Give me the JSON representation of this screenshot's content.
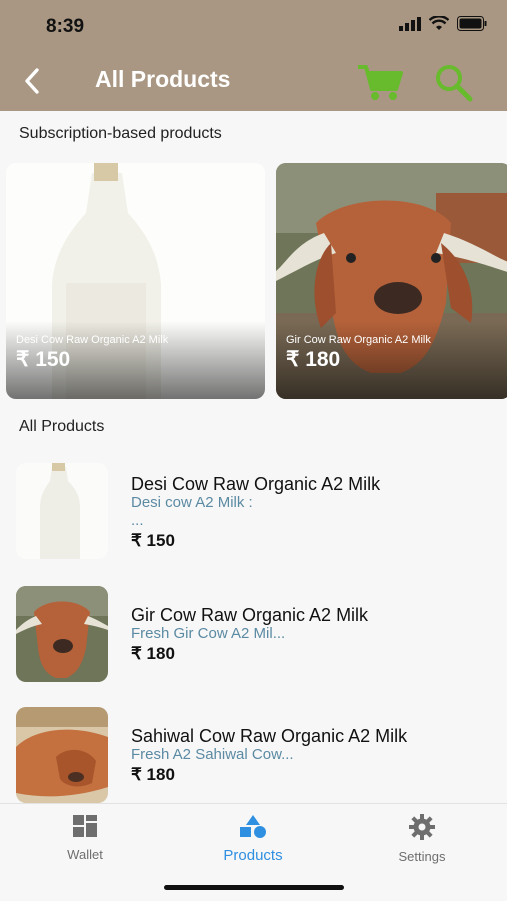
{
  "status_bar": {
    "time": "8:39"
  },
  "header": {
    "title": "All Products"
  },
  "sections": {
    "subscription_label": "Subscription-based products",
    "all_label": "All Products"
  },
  "subscription_cards": [
    {
      "name": "Desi Cow Raw Organic A2 Milk",
      "price": "₹ 150"
    },
    {
      "name": "Gir Cow Raw Organic A2 Milk",
      "price": "₹ 180"
    }
  ],
  "products": [
    {
      "name": "Desi Cow Raw Organic A2 Milk",
      "desc": "Desi cow A2 Milk :",
      "desc2": "...",
      "price": "₹ 150"
    },
    {
      "name": "Gir Cow Raw Organic A2 Milk",
      "desc": "Fresh Gir Cow A2 Mil...",
      "price": "₹ 180"
    },
    {
      "name": "Sahiwal Cow Raw Organic A2 Milk",
      "desc": "Fresh A2 Sahiwal Cow...",
      "price": "₹ 180"
    }
  ],
  "tabs": [
    {
      "label": "Wallet",
      "icon": "wallet-icon"
    },
    {
      "label": "Products",
      "icon": "products-icon",
      "active": true
    },
    {
      "label": "Settings",
      "icon": "gear-icon"
    }
  ],
  "colors": {
    "header": "#a99783",
    "accent_green": "#67bb2c",
    "tab_active": "#2f8fe0",
    "desc_text": "#5b8aa3"
  }
}
